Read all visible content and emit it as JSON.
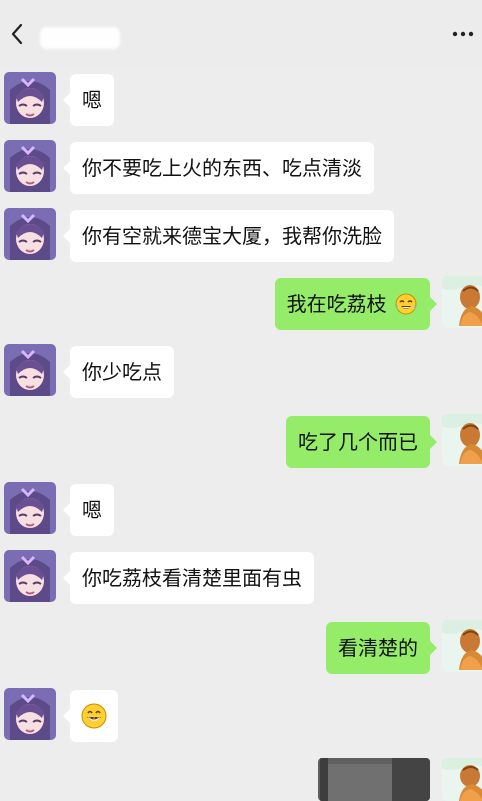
{
  "header": {
    "title": "",
    "back_icon": "chevron-left-icon",
    "more_icon": "more-icon"
  },
  "messages": [
    {
      "side": "left",
      "text": "嗯"
    },
    {
      "side": "left",
      "text": "你不要吃上火的东西、吃点清淡"
    },
    {
      "side": "left",
      "text": "你有空就来德宝大厦，我帮你洗脸"
    },
    {
      "side": "right",
      "text": "我在吃荔枝",
      "emoji": "tears-of-joy-emoji"
    },
    {
      "side": "left",
      "text": "你少吃点"
    },
    {
      "side": "right",
      "text": "吃了几个而已"
    },
    {
      "side": "left",
      "text": "嗯"
    },
    {
      "side": "left",
      "text": "你吃荔枝看清楚里面有虫"
    },
    {
      "side": "right",
      "text": "看清楚的"
    },
    {
      "side": "left",
      "emoji": "grin-emoji"
    },
    {
      "side": "right",
      "image": "photo-thumbnail"
    }
  ],
  "colors": {
    "background": "#ededed",
    "incoming_bubble": "#ffffff",
    "outgoing_bubble": "#95ec69",
    "text": "#111111"
  }
}
